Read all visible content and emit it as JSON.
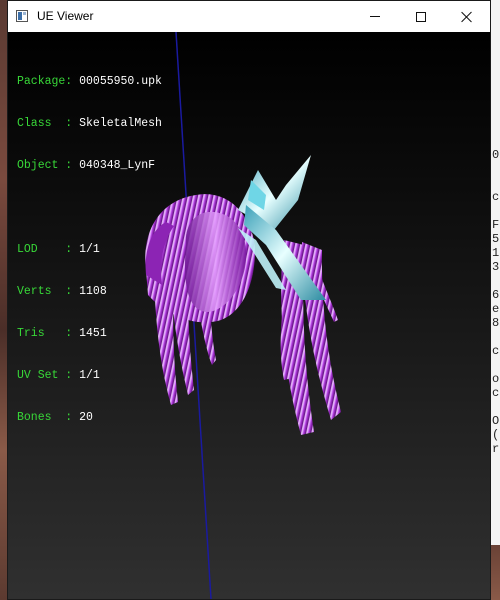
{
  "window": {
    "title": "UE Viewer",
    "icon": "app-window-icon",
    "controls": {
      "minimize": "minimize-icon",
      "maximize": "maximize-icon",
      "close": "close-icon"
    }
  },
  "info": {
    "package_label": "Package: ",
    "package_value": "00055950.upk",
    "class_label": "Class  : ",
    "class_value": "SkeletalMesh",
    "object_label": "Object : ",
    "object_value": "040348_LynF",
    "lod_label": "LOD    : ",
    "lod_value": "1/1",
    "verts_label": "Verts  : ",
    "verts_value": "1108",
    "tris_label": "Tris   : ",
    "tris_value": "1451",
    "uvset_label": "UV Set : ",
    "uvset_value": "1/1",
    "bones_label": "Bones  : ",
    "bones_value": "20"
  },
  "console_glyphs": [
    "",
    "0",
    "",
    "",
    "c",
    "",
    "F",
    "5",
    "1",
    "3",
    "",
    "6",
    "e",
    "8",
    "",
    "c",
    "",
    "o",
    "c",
    "",
    "O",
    "(",
    "r"
  ],
  "colors": {
    "info_key": "#38d838",
    "info_value": "#ffffff",
    "axis": "#1a1aa0",
    "hair": "#b040d0",
    "ribbon": "#6ad0e0"
  }
}
